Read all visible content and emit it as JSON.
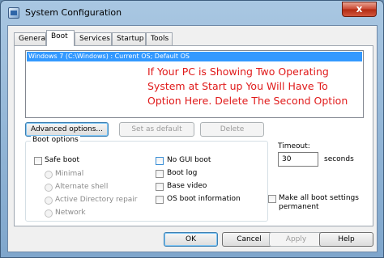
{
  "window": {
    "title": "System Configuration",
    "close_glyph": "x"
  },
  "tabs": [
    {
      "label": "General"
    },
    {
      "label": "Boot"
    },
    {
      "label": "Services"
    },
    {
      "label": "Startup"
    },
    {
      "label": "Tools"
    }
  ],
  "boot_list": {
    "entries": [
      "Windows 7 (C:\\Windows) : Current OS; Default OS"
    ]
  },
  "annotation": "If Your PC is Showing Two Operating System at Start up You Will Have To Option Here. Delete The Second Option",
  "list_buttons": {
    "advanced": "Advanced options...",
    "set_default": "Set as default",
    "delete": "Delete"
  },
  "boot_options": {
    "label": "Boot options",
    "safe_boot": "Safe boot",
    "minimal": "Minimal",
    "alternate_shell": "Alternate shell",
    "active_directory_repair": "Active Directory repair",
    "network": "Network",
    "no_gui_boot": "No GUI boot",
    "boot_log": "Boot log",
    "base_video": "Base video",
    "os_boot_information": "OS boot information"
  },
  "timeout": {
    "label": "Timeout:",
    "value": "30",
    "unit": "seconds"
  },
  "make_permanent": "Make all boot settings permanent",
  "dialog_buttons": {
    "ok": "OK",
    "cancel": "Cancel",
    "apply": "Apply",
    "help": "Help"
  },
  "colors": {
    "selection": "#3399ff",
    "annotation": "#e01a1a"
  }
}
